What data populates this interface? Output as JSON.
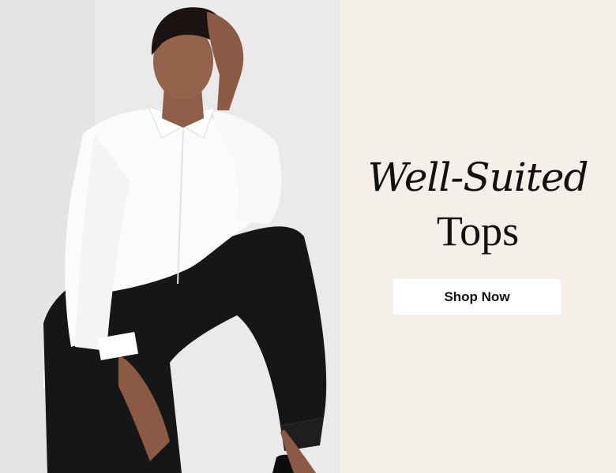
{
  "promo": {
    "headline_line1": "Well-Suited",
    "headline_line2": "Tops",
    "cta_label": "Shop Now"
  },
  "colors": {
    "panel_background": "#f5efea",
    "photo_background": "#e9e9e8",
    "button_background": "#ffffff",
    "text": "#111111"
  }
}
